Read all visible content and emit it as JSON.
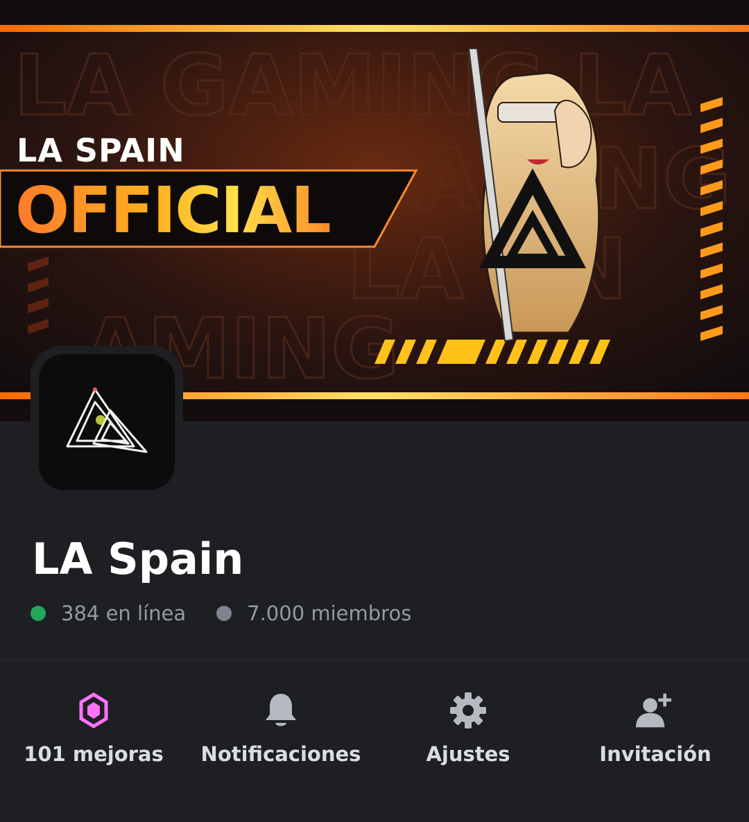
{
  "banner": {
    "title_small": "LA SPAIN",
    "title_big": "OFFICIAL"
  },
  "server": {
    "name": "LA Spain",
    "online_text": "384 en línea",
    "members_text": "7.000 miembros",
    "online_color": "#23a55a",
    "members_color": "#80848e"
  },
  "actions": [
    {
      "label": "101 mejoras",
      "icon": "boost-gem-icon",
      "color": "#ff73fa"
    },
    {
      "label": "Notificaciones",
      "icon": "bell-icon",
      "color": "#b5bac1"
    },
    {
      "label": "Ajustes",
      "icon": "gear-icon",
      "color": "#b5bac1"
    },
    {
      "label": "Invitación",
      "icon": "add-user-icon",
      "color": "#b5bac1"
    }
  ]
}
